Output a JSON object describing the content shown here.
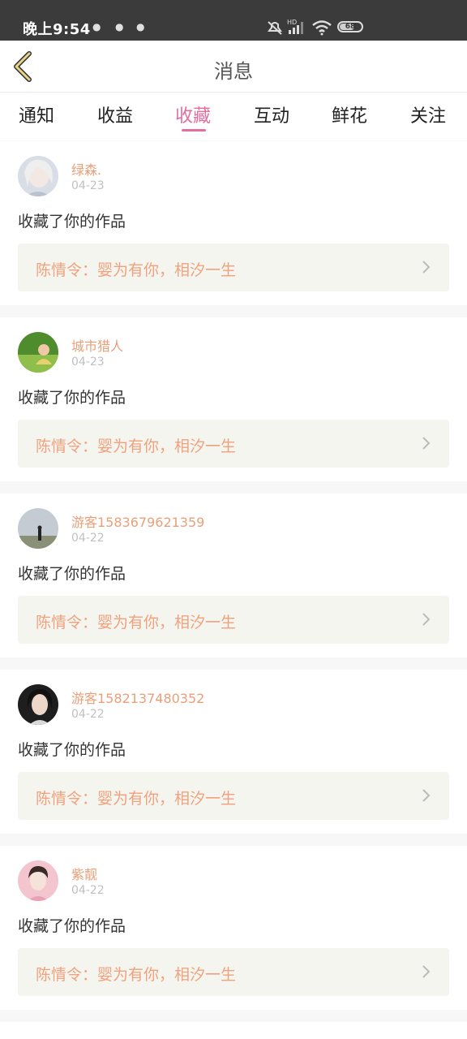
{
  "statusbar": {
    "time": "晚上9:54",
    "battery": "68"
  },
  "header": {
    "title": "消息"
  },
  "tabs": [
    {
      "label": "通知"
    },
    {
      "label": "收益"
    },
    {
      "label": "收藏"
    },
    {
      "label": "互动"
    },
    {
      "label": "鲜花"
    },
    {
      "label": "关注"
    }
  ],
  "active_tab": "收藏",
  "colors": {
    "accent": "#e46ea0",
    "name": "#e8a07a",
    "work_title": "#f0a27e",
    "work_box_bg": "#f5f5ef"
  },
  "notifications": [
    {
      "name": "绿森.",
      "date": "04-23",
      "message": "收藏了你的作品",
      "work": "陈情令：婴为有你，相汐一生"
    },
    {
      "name": "城市猎人",
      "date": "04-23",
      "message": "收藏了你的作品",
      "work": "陈情令：婴为有你，相汐一生"
    },
    {
      "name": "游客1583679621359",
      "date": "04-22",
      "message": "收藏了你的作品",
      "work": "陈情令：婴为有你，相汐一生"
    },
    {
      "name": "游客1582137480352",
      "date": "04-22",
      "message": "收藏了你的作品",
      "work": "陈情令：婴为有你，相汐一生"
    },
    {
      "name": "紫靓",
      "date": "04-22",
      "message": "收藏了你的作品",
      "work": "陈情令：婴为有你，相汐一生"
    }
  ]
}
